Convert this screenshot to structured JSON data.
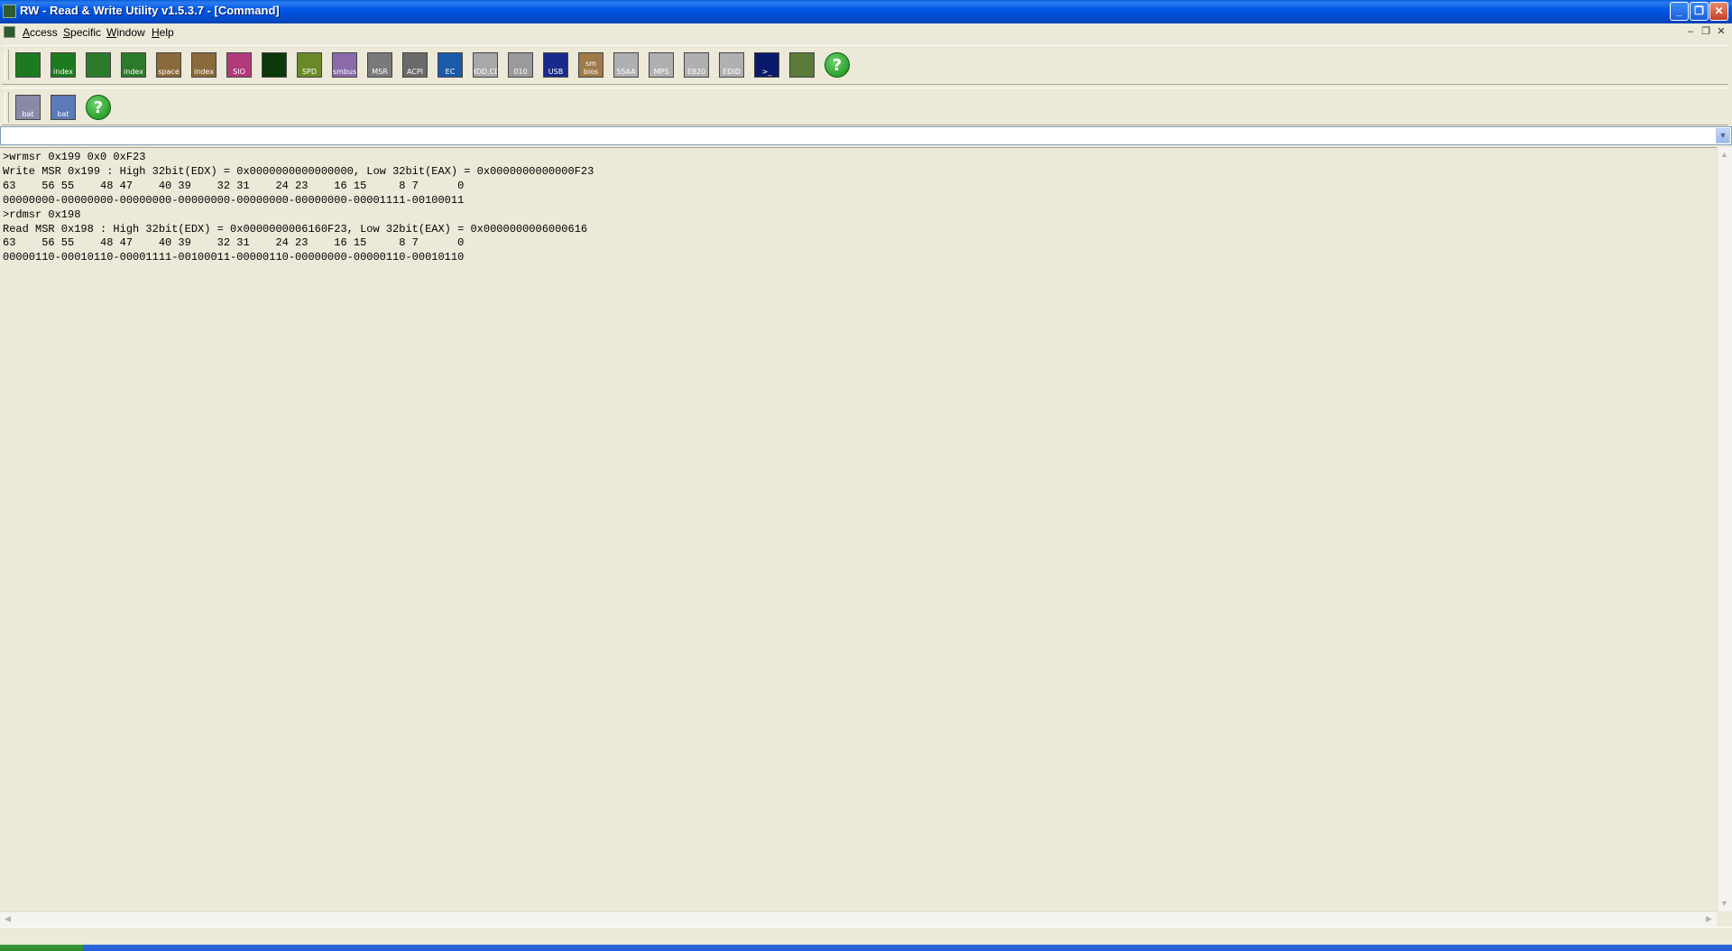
{
  "window": {
    "title": "RW - Read & Write Utility v1.5.3.7 - [Command]",
    "minimize": "_",
    "maximize": "❐",
    "close": "✕"
  },
  "menu": {
    "items": [
      {
        "key": "A",
        "rest": "ccess"
      },
      {
        "key": "S",
        "rest": "pecific"
      },
      {
        "key": "W",
        "rest": "indow"
      },
      {
        "key": "H",
        "rest": "elp"
      }
    ],
    "mdi_minimize": "–",
    "mdi_restore": "❐",
    "mdi_close": "✕"
  },
  "toolbar1": [
    {
      "name": "pci-icon",
      "label": "",
      "color": "#1e7a1e"
    },
    {
      "name": "pci-index-icon",
      "label": "index",
      "color": "#1e7a1e"
    },
    {
      "name": "memory-icon",
      "label": "",
      "color": "#2c7a2c"
    },
    {
      "name": "memory-index-icon",
      "label": "index",
      "color": "#2c7a2c"
    },
    {
      "name": "io-space-icon",
      "label": "space",
      "color": "#8a6a3a"
    },
    {
      "name": "io-index-icon",
      "label": "index",
      "color": "#8a6a3a"
    },
    {
      "name": "sio-icon",
      "label": "SIO",
      "color": "#b03a7a"
    },
    {
      "name": "waveform-icon",
      "label": "",
      "color": "#0a3a0a"
    },
    {
      "name": "spd-icon",
      "label": "SPD",
      "color": "#6a8a2a"
    },
    {
      "name": "smbus-icon",
      "label": "smbus",
      "color": "#8a6aa8"
    },
    {
      "name": "msr-icon",
      "label": "MSR",
      "color": "#7a7a7a"
    },
    {
      "name": "acpi-icon",
      "label": "ACPI",
      "color": "#6a6a6a"
    },
    {
      "name": "ec-icon",
      "label": "EC",
      "color": "#1a5aa8"
    },
    {
      "name": "hdd-cd-icon",
      "label": "HDD,CD",
      "color": "#a8a8a8"
    },
    {
      "name": "disk-icon",
      "label": "010",
      "color": "#9a9a9a"
    },
    {
      "name": "usb-icon",
      "label": "USB",
      "color": "#1a2a8a"
    },
    {
      "name": "smbios-icon",
      "label": "sm bios",
      "color": "#a07a4a"
    },
    {
      "name": "55aa-icon",
      "label": "55AA",
      "color": "#b0b0b0"
    },
    {
      "name": "mps-icon",
      "label": "MPS",
      "color": "#b0b0b0"
    },
    {
      "name": "e820-icon",
      "label": "E820",
      "color": "#b0b0b0"
    },
    {
      "name": "edid-icon",
      "label": "EDID",
      "color": "#b0b0b0"
    },
    {
      "name": "command-icon",
      "label": ">_",
      "color": "#0a1a6a"
    },
    {
      "name": "tools-icon",
      "label": "",
      "color": "#5a7a3a"
    },
    {
      "name": "help-icon",
      "label": "?",
      "color": "#138a13",
      "help": true
    }
  ],
  "toolbar2": [
    {
      "name": "save-bat-icon",
      "label": "bat",
      "color": "#8a8aa8"
    },
    {
      "name": "run-bat-icon",
      "label": "bat",
      "color": "#5a7ab8"
    },
    {
      "name": "help-icon",
      "label": "?",
      "color": "#138a13",
      "help": true
    }
  ],
  "command": {
    "value": "",
    "drop_glyph": "▼"
  },
  "output": {
    "lines": [
      ">wrmsr 0x199 0x0 0xF23",
      "Write MSR 0x199 : High 32bit(EDX) = 0x0000000000000000, Low 32bit(EAX) = 0x0000000000000F23",
      "63    56 55    48 47    40 39    32 31    24 23    16 15     8 7      0",
      "00000000-00000000-00000000-00000000-00000000-00000000-00001111-00100011",
      ">rdmsr 0x198",
      "Read MSR 0x198 : High 32bit(EDX) = 0x0000000006160F23, Low 32bit(EAX) = 0x0000000006000616",
      "63    56 55    48 47    40 39    32 31    24 23    16 15     8 7      0",
      "00000110-00010110-00001111-00100011-00000110-00000000-00000110-00010110"
    ]
  },
  "scroll": {
    "up": "▲",
    "down": "▼",
    "left": "◀",
    "right": "▶"
  }
}
